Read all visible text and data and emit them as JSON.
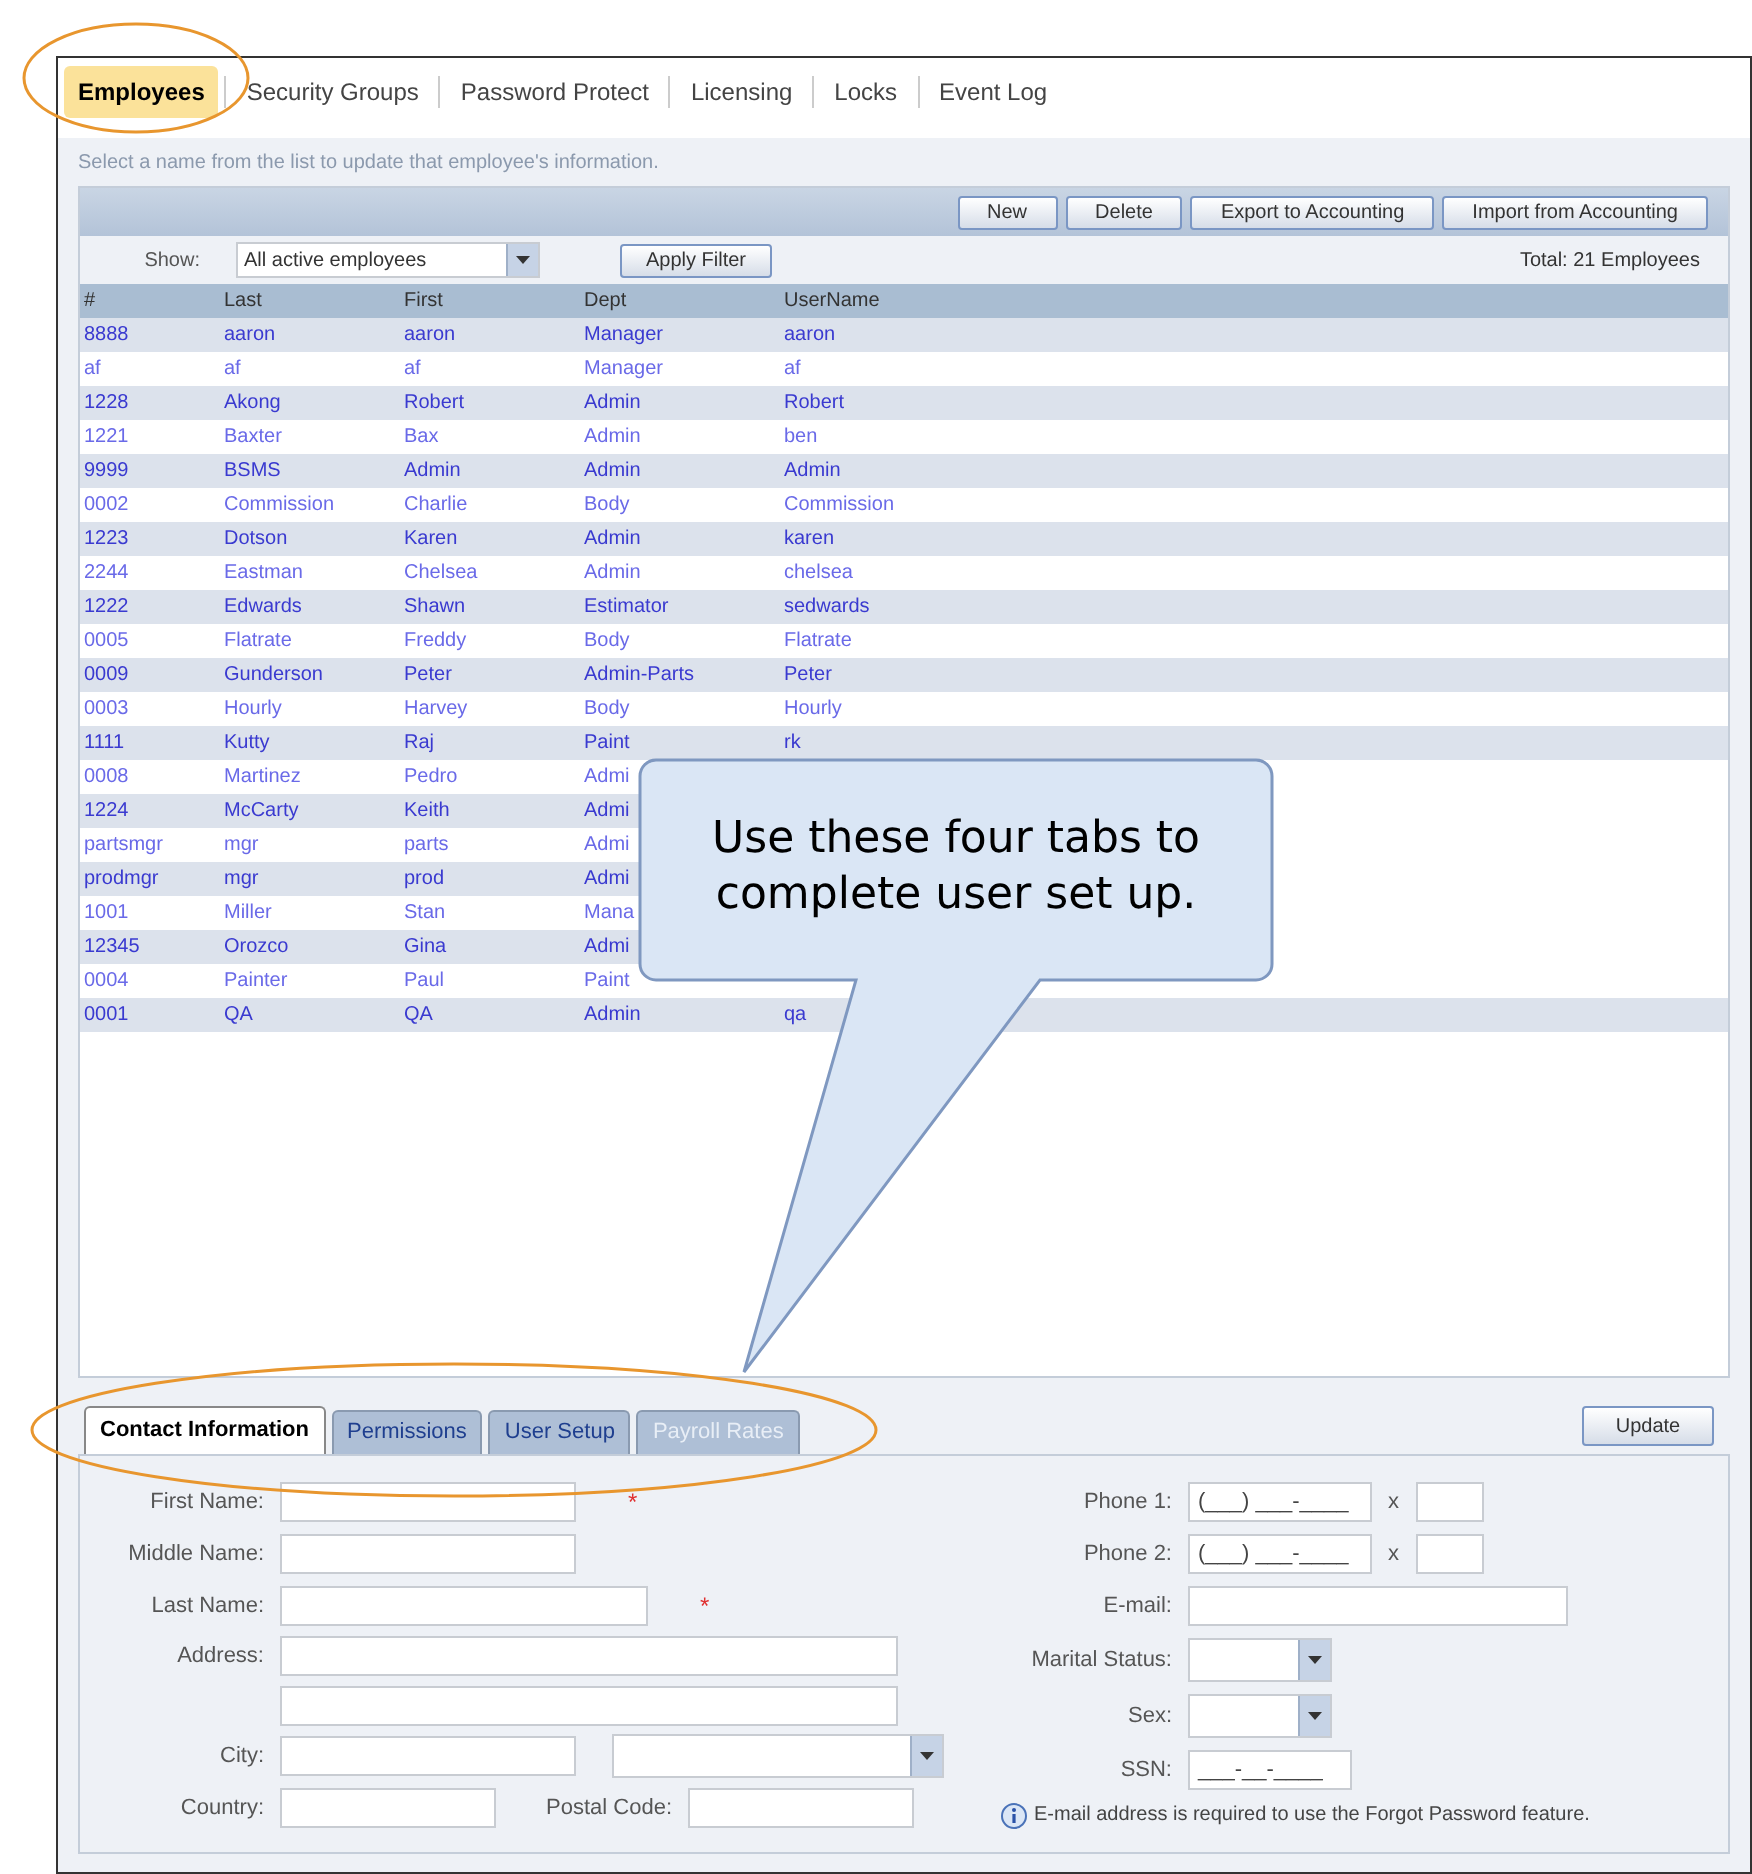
{
  "top_tabs": [
    {
      "label": "Employees",
      "selected": true
    },
    {
      "label": "Security Groups",
      "selected": false
    },
    {
      "label": "Password Protect",
      "selected": false
    },
    {
      "label": "Licensing",
      "selected": false
    },
    {
      "label": "Locks",
      "selected": false
    },
    {
      "label": "Event Log",
      "selected": false
    }
  ],
  "instruction": "Select a name from the list to update that employee's information.",
  "toolbar": {
    "buttons": [
      "New",
      "Delete",
      "Export to Accounting",
      "Import from Accounting"
    ]
  },
  "filter": {
    "label": "Show:",
    "value": "All active employees",
    "button": "Apply Filter",
    "total": "Total: 21 Employees"
  },
  "table": {
    "columns": [
      "#",
      "Last",
      "First",
      "Dept",
      "UserName"
    ],
    "rows": [
      [
        "8888",
        "aaron",
        "aaron",
        "Manager",
        "aaron"
      ],
      [
        "af",
        "af",
        "af",
        "Manager",
        "af"
      ],
      [
        "1228",
        "Akong",
        "Robert",
        "Admin",
        "Robert"
      ],
      [
        "1221",
        "Baxter",
        "Bax",
        "Admin",
        "ben"
      ],
      [
        "9999",
        "BSMS",
        "Admin",
        "Admin",
        "Admin"
      ],
      [
        "0002",
        "Commission",
        "Charlie",
        "Body",
        "Commission"
      ],
      [
        "1223",
        "Dotson",
        "Karen",
        "Admin",
        "karen"
      ],
      [
        "2244",
        "Eastman",
        "Chelsea",
        "Admin",
        "chelsea"
      ],
      [
        "1222",
        "Edwards",
        "Shawn",
        "Estimator",
        "sedwards"
      ],
      [
        "0005",
        "Flatrate",
        "Freddy",
        "Body",
        "Flatrate"
      ],
      [
        "0009",
        "Gunderson",
        "Peter",
        "Admin-Parts",
        "Peter"
      ],
      [
        "0003",
        "Hourly",
        "Harvey",
        "Body",
        "Hourly"
      ],
      [
        "1111",
        "Kutty",
        "Raj",
        "Paint",
        "rk"
      ],
      [
        "0008",
        "Martinez",
        "Pedro",
        "Admi"
      ],
      [
        "1224",
        "McCarty",
        "Keith",
        "Admi"
      ],
      [
        "partsmgr",
        "mgr",
        "parts",
        "Admi"
      ],
      [
        "prodmgr",
        "mgr",
        "prod",
        "Admi"
      ],
      [
        "1001",
        "Miller",
        "Stan",
        "Mana"
      ],
      [
        "12345",
        "Orozco",
        "Gina",
        "Admi"
      ],
      [
        "0004",
        "Painter",
        "Paul",
        "Paint"
      ],
      [
        "0001",
        "QA",
        "QA",
        "Admin",
        "qa"
      ]
    ]
  },
  "detail_tabs": [
    {
      "label": "Contact Information",
      "selected": true,
      "disabled": false
    },
    {
      "label": "Permissions",
      "selected": false,
      "disabled": false
    },
    {
      "label": "User Setup",
      "selected": false,
      "disabled": false
    },
    {
      "label": "Payroll Rates",
      "selected": false,
      "disabled": true
    }
  ],
  "update_button": "Update",
  "form": {
    "required_mark": "*",
    "left": [
      {
        "kind": "text",
        "label": "First Name:",
        "required": true
      },
      {
        "kind": "text",
        "label": "Middle Name:",
        "required": false
      },
      {
        "kind": "text",
        "label": "Last Name:",
        "required": true
      },
      {
        "kind": "address",
        "label": "Address:",
        "required": false
      },
      {
        "kind": "city",
        "label": "City:",
        "required": false
      },
      {
        "kind": "country",
        "label": "Country:",
        "second_label": "Postal Code:",
        "required": false
      }
    ],
    "right": [
      {
        "kind": "phone",
        "label": "Phone 1:",
        "value": "(___) ___-____",
        "ext_label": "x"
      },
      {
        "kind": "phone",
        "label": "Phone 2:",
        "value": "(___) ___-____",
        "ext_label": "x"
      },
      {
        "kind": "email",
        "label": "E-mail:"
      },
      {
        "kind": "select",
        "label": "Marital Status:"
      },
      {
        "kind": "select",
        "label": "Sex:"
      },
      {
        "kind": "ssn",
        "label": "SSN:",
        "value": "___-__-____"
      }
    ],
    "note": "E-mail address is required to use the Forgot Password feature."
  },
  "callout": "Use these four tabs to complete user set up."
}
